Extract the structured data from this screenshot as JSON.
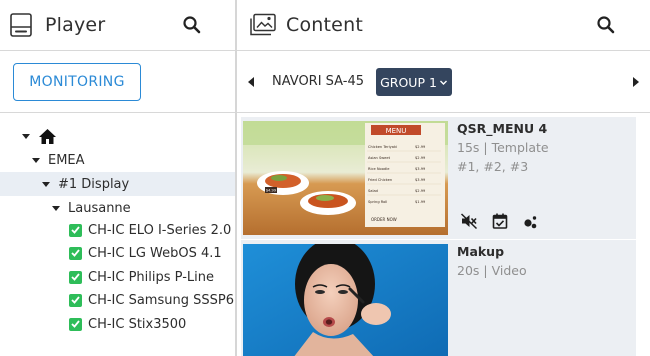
{
  "player_panel": {
    "title": "Player",
    "monitoring_label": "MONITORING",
    "tree": {
      "region": "EMEA",
      "display": "#1 Display",
      "city": "Lausanne",
      "devices": [
        "CH-IC ELO I-Series 2.0",
        "CH-IC LG WebOS 4.1",
        "CH-IC Philips P-Line",
        "CH-IC Samsung SSSP6",
        "CH-IC Stix3500"
      ]
    }
  },
  "content_panel": {
    "title": "Content",
    "player_name": "NAVORI SA-45",
    "group_label": "GROUP 1",
    "items": [
      {
        "name": "QSR_MENU 4",
        "meta": "15s | Template",
        "tags": "#1, #2, #3",
        "thumbnail_text": {
          "menu_header": "MENU",
          "entries": [
            [
              "Chicken Teriyaki",
              "$2.99"
            ],
            [
              "Asian Sweet",
              "$2.99"
            ],
            [
              "Rice Noodle",
              "$3.99"
            ],
            [
              "Fried Chicken",
              "$3.99"
            ],
            [
              "Salad",
              "$2.99"
            ],
            [
              "Spring Roll",
              "$1.99"
            ]
          ],
          "price_badge": "$4.99",
          "footer": "ORDER NOW"
        }
      },
      {
        "name": "Makup",
        "meta": "20s | Video",
        "tags": ""
      }
    ]
  },
  "colors": {
    "accent": "#2b8ad6",
    "chip": "#34455e",
    "status_ok": "#2ebd59",
    "card_bg": "#eceff3",
    "selected_row": "#e9eef4"
  },
  "icons": {
    "player_header": "player-device-icon",
    "content_header": "image-gallery-icon",
    "search": "search-icon",
    "home": "home-icon",
    "card_actions": [
      "mute-icon",
      "calendar-check-icon",
      "bubbles-icon"
    ]
  }
}
